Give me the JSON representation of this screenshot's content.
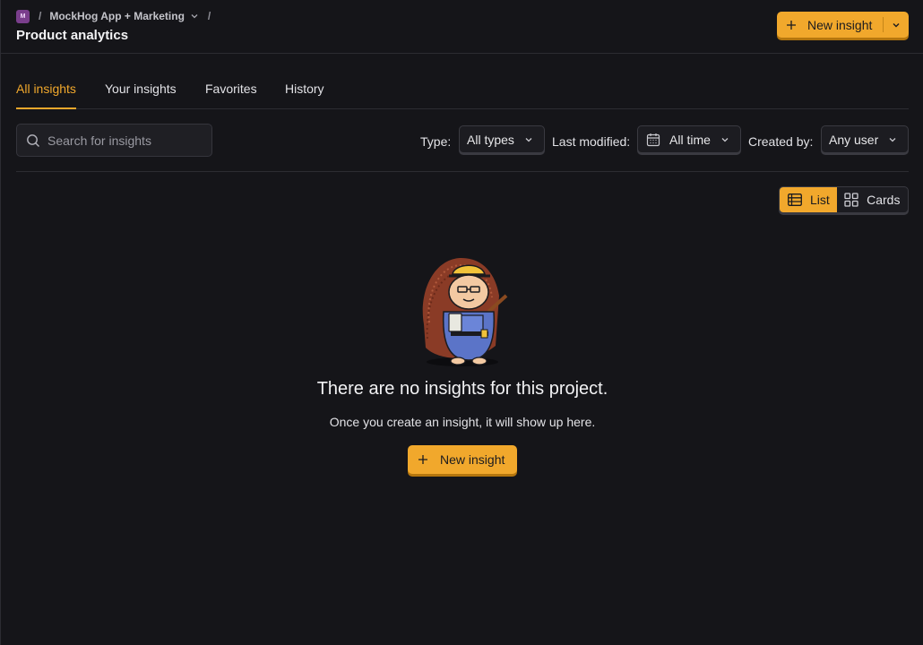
{
  "breadcrumb": {
    "project_initial": "M",
    "separator": "/",
    "project_name": "MockHog App + Marketing",
    "trailing_separator": "/"
  },
  "page": {
    "title": "Product analytics"
  },
  "header": {
    "new_insight_label": "New insight"
  },
  "tabs": [
    {
      "label": "All insights",
      "active": true
    },
    {
      "label": "Your insights",
      "active": false
    },
    {
      "label": "Favorites",
      "active": false
    },
    {
      "label": "History",
      "active": false
    }
  ],
  "filters": {
    "search_placeholder": "Search for insights",
    "search_value": "",
    "type_label": "Type:",
    "type_value": "All types",
    "modified_label": "Last modified:",
    "modified_value": "All time",
    "created_label": "Created by:",
    "created_value": "Any user"
  },
  "view_toggle": {
    "list_label": "List",
    "cards_label": "Cards",
    "selected": "List"
  },
  "empty_state": {
    "title": "There are no insights for this project.",
    "subtitle": "Once you create an insight, it will show up here.",
    "button_label": "New insight"
  },
  "colors": {
    "accent": "#f1a82c",
    "background": "#151519",
    "border": "#2c2c32",
    "project_avatar": "#7a3e8c"
  },
  "icons": [
    "chevron-down-icon",
    "plus-icon",
    "search-icon",
    "calendar-icon",
    "list-icon",
    "grid-icon",
    "hedgehog-illustration"
  ]
}
